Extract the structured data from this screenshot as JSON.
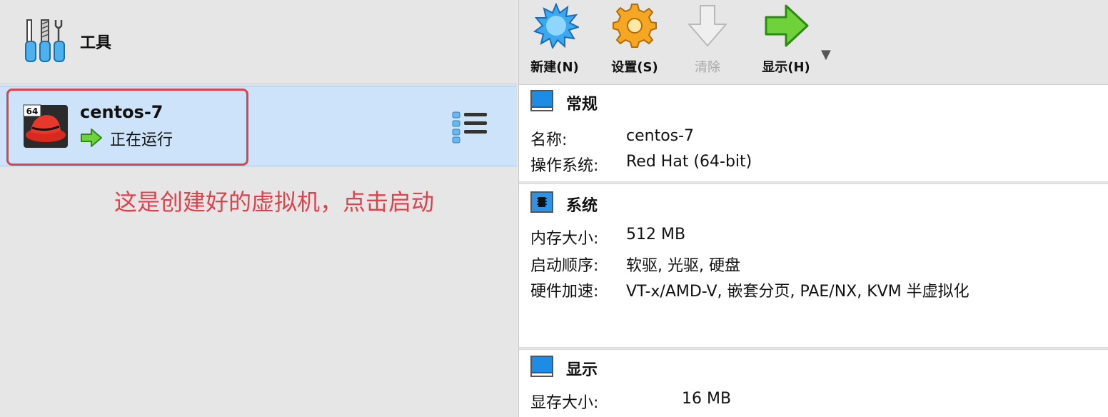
{
  "tools": {
    "label": "工具",
    "icon": "tools-icon"
  },
  "vm": {
    "name": "centos-7",
    "state": "正在运行",
    "os_badge": "64",
    "os_icon": "redhat-os-icon"
  },
  "annotation": "这是创建好的虚拟机，点击启动",
  "toolbar": {
    "new_label": "新建(N)",
    "settings_label": "设置(S)",
    "discard_label": "清除",
    "show_label": "显示(H)",
    "more": "▼"
  },
  "details": {
    "general": {
      "title": "常规",
      "name_key": "名称:",
      "name_val": "centos-7",
      "os_key": "操作系统:",
      "os_val": "Red Hat (64-bit)"
    },
    "system": {
      "title": "系统",
      "mem_key": "内存大小:",
      "mem_val": "512 MB",
      "boot_key": "启动顺序:",
      "boot_val": "软驱, 光驱, 硬盘",
      "accel_key": "硬件加速:",
      "accel_val": "VT-x/AMD-V, 嵌套分页, PAE/NX, KVM 半虚拟化"
    },
    "display": {
      "title": "显示",
      "vram_key": "显存大小:",
      "vram_val": "16 MB"
    }
  },
  "colors": {
    "accent_red": "#e0414a",
    "selection": "#cde3f9"
  }
}
